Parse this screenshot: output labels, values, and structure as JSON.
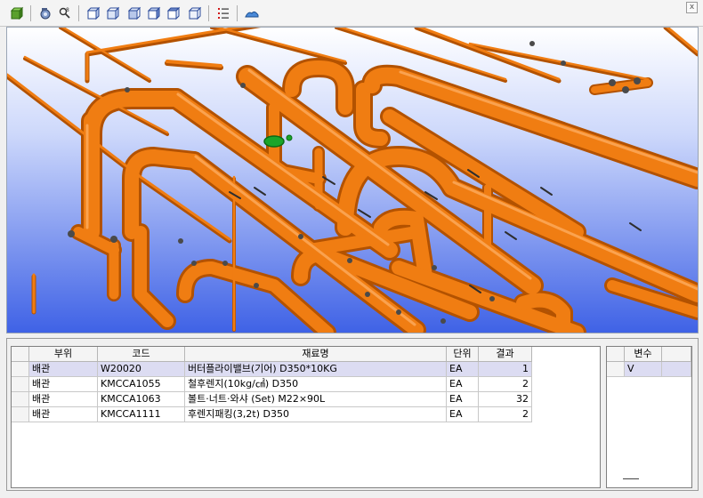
{
  "toolbar": {
    "buttons": [
      {
        "name": "add-model-button",
        "icon": "green-cube-plus-icon"
      },
      {
        "name": "camera-view-button",
        "icon": "camera-icon"
      },
      {
        "name": "search-model-button",
        "icon": "search-icon"
      },
      {
        "name": "view-front-button",
        "icon": "box-front-icon"
      },
      {
        "name": "view-back-button",
        "icon": "box-back-icon"
      },
      {
        "name": "view-left-button",
        "icon": "box-left-icon"
      },
      {
        "name": "view-right-button",
        "icon": "box-right-icon"
      },
      {
        "name": "view-top-button",
        "icon": "box-top-icon"
      },
      {
        "name": "view-iso-button",
        "icon": "box-iso-icon"
      },
      {
        "name": "material-list-button",
        "icon": "list-icon"
      },
      {
        "name": "terrain-button",
        "icon": "terrain-icon"
      }
    ],
    "close_label": "x"
  },
  "viewport": {
    "background_top": "#ffffff",
    "background_bottom": "#3f62e6",
    "pipe_color": "#f07d12",
    "pipe_shadow": "#b35200",
    "highlight_color": "#1aa52a"
  },
  "material_table": {
    "columns": [
      "부위",
      "코드",
      "재료명",
      "단위",
      "결과"
    ],
    "rows": [
      {
        "part": "배관",
        "code": "W20020",
        "name": "버터플라이밸브(기어) D350*10KG",
        "unit": "EA",
        "result": "1",
        "selected": true
      },
      {
        "part": "배관",
        "code": "KMCCA1055",
        "name": "철후렌지(10kg/㎠) D350",
        "unit": "EA",
        "result": "2",
        "selected": false
      },
      {
        "part": "배관",
        "code": "KMCCA1063",
        "name": "볼트·너트·와샤 (Set) M22×90L",
        "unit": "EA",
        "result": "32",
        "selected": false
      },
      {
        "part": "배관",
        "code": "KMCCA1111",
        "name": "후렌지패킹(3,2t) D350",
        "unit": "EA",
        "result": "2",
        "selected": false
      }
    ]
  },
  "variable_table": {
    "columns": [
      "변수"
    ],
    "rows": [
      {
        "name": "V"
      }
    ]
  }
}
